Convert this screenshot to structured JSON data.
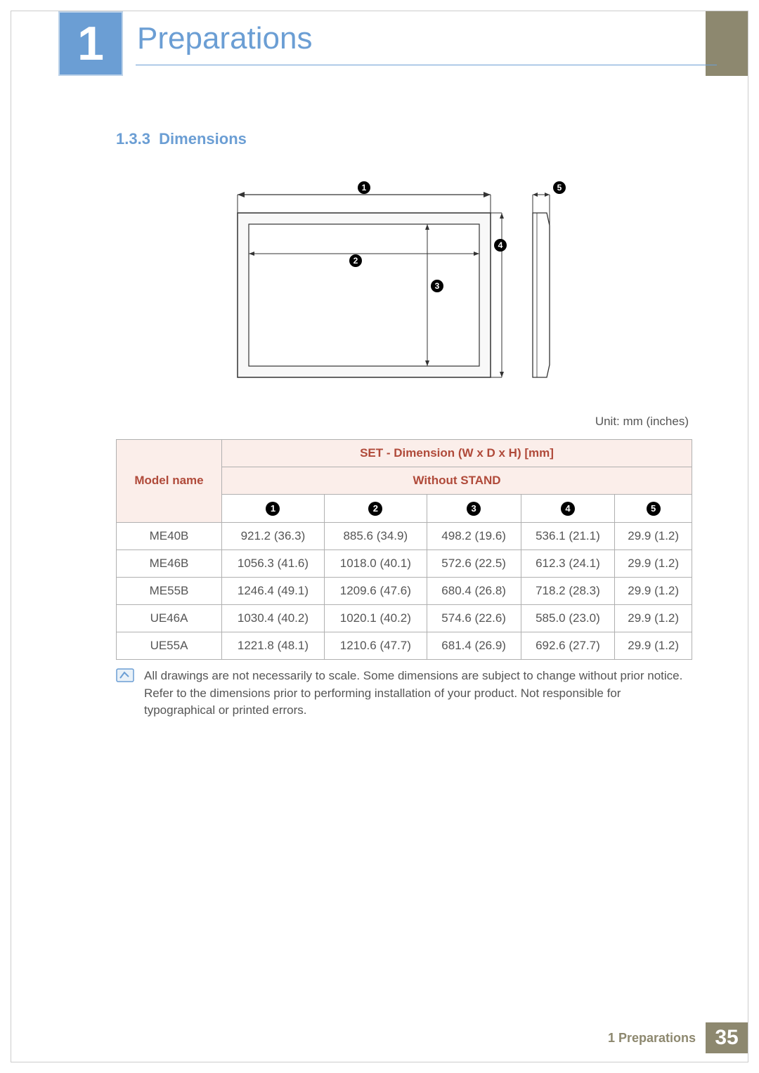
{
  "chapter": {
    "number": "1",
    "title": "Preparations"
  },
  "section": {
    "number": "1.3.3",
    "title": "Dimensions"
  },
  "unit_label": "Unit: mm (inches)",
  "table": {
    "model_header": "Model name",
    "set_header": "SET - Dimension (W x D x H) [mm]",
    "without_stand": "Without STAND",
    "col_nums": [
      "1",
      "2",
      "3",
      "4",
      "5"
    ],
    "rows": [
      {
        "model": "ME40B",
        "c1": "921.2 (36.3)",
        "c2": "885.6 (34.9)",
        "c3": "498.2 (19.6)",
        "c4": "536.1 (21.1)",
        "c5": "29.9 (1.2)"
      },
      {
        "model": "ME46B",
        "c1": "1056.3 (41.6)",
        "c2": "1018.0 (40.1)",
        "c3": "572.6 (22.5)",
        "c4": "612.3 (24.1)",
        "c5": "29.9 (1.2)"
      },
      {
        "model": "ME55B",
        "c1": "1246.4 (49.1)",
        "c2": "1209.6 (47.6)",
        "c3": "680.4 (26.8)",
        "c4": "718.2 (28.3)",
        "c5": "29.9 (1.2)"
      },
      {
        "model": "UE46A",
        "c1": "1030.4 (40.2)",
        "c2": "1020.1 (40.2)",
        "c3": "574.6 (22.6)",
        "c4": "585.0 (23.0)",
        "c5": "29.9 (1.2)"
      },
      {
        "model": "UE55A",
        "c1": "1221.8 (48.1)",
        "c2": "1210.6 (47.7)",
        "c3": "681.4 (26.9)",
        "c4": "692.6 (27.7)",
        "c5": "29.9 (1.2)"
      }
    ]
  },
  "note": "All drawings are not necessarily to scale. Some dimensions are subject to change without prior notice. Refer to the dimensions prior to performing installation of your product. Not responsible for typographical or printed errors.",
  "footer": {
    "text": "1 Preparations",
    "page": "35"
  },
  "diagram_callouts": [
    "1",
    "2",
    "3",
    "4",
    "5"
  ]
}
